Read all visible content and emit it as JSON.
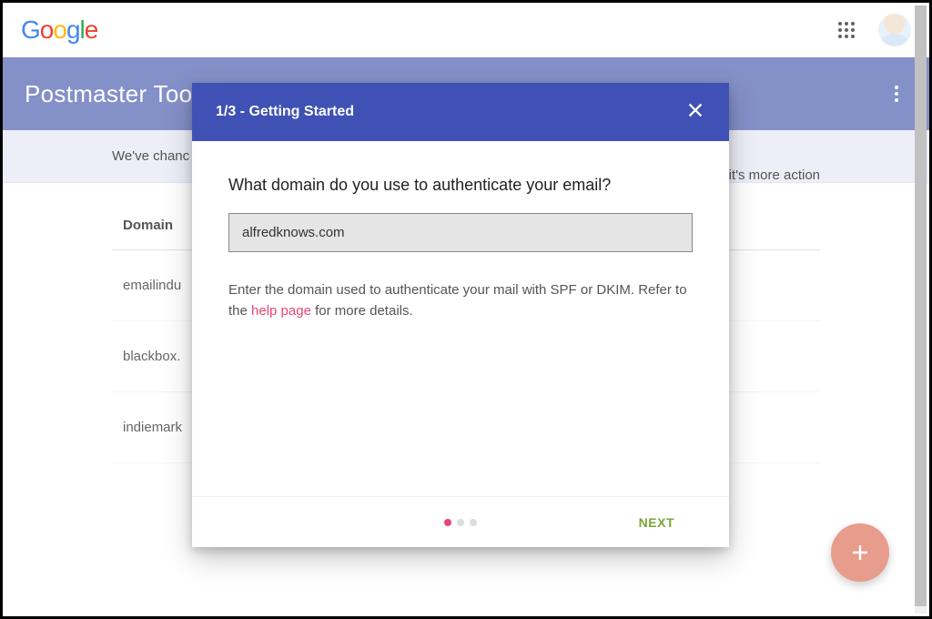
{
  "brand": "Google",
  "appbar": {
    "title": "Postmaster Tools"
  },
  "banner": {
    "text_prefix": "We've chanc",
    "text_suffix": "sure it's more action"
  },
  "table": {
    "header": "Domain",
    "rows": [
      "emailindu",
      "blackbox.",
      "indiemark"
    ]
  },
  "modal": {
    "step_label": "1/3 - Getting Started",
    "question": "What domain do you use to authenticate your email?",
    "input_value": "alfredknows.com",
    "helper_before": "Enter the domain used to authenticate your mail with SPF or DKIM. Refer to the ",
    "helper_link": "help page",
    "helper_after": " for more details.",
    "next_label": "NEXT"
  }
}
